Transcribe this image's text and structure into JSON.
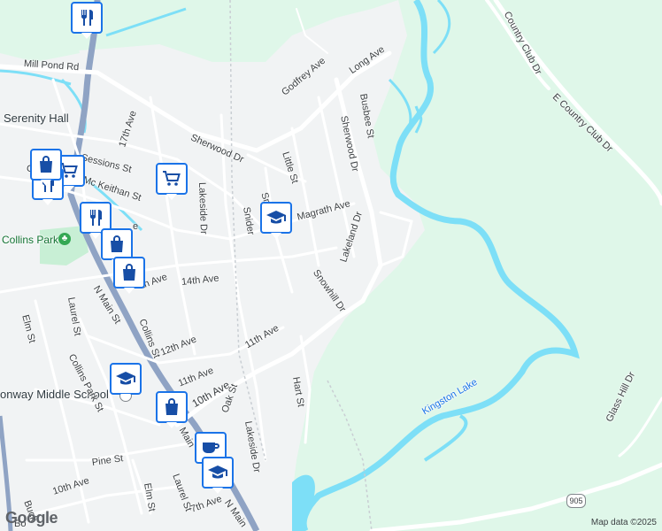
{
  "map": {
    "attribution": "Map data ©2025",
    "logo": "Google",
    "colors": {
      "urban": "#f1f3f4",
      "green": "#dff7e9",
      "water": "#7ddff7",
      "road": "#ffffff",
      "highway": "#8fa3c4",
      "pin_border": "#1a73e8",
      "pin_icon": "#174ea6"
    },
    "places": {
      "serenity_hall": "Serenity Hall",
      "collins_park": "Collins Park",
      "middle_school": "onway Middle School",
      "kingston_lake": "Kingston Lake"
    },
    "streets": {
      "mill_pond": "Mill Pond Rd",
      "long_ave": "Long Ave",
      "godfrey": "Godfrey Ave",
      "busbee": "Busbee St",
      "sherwood_dr": "Sherwood Dr",
      "sherwood_dr2": "Sherwood Dr",
      "little": "Little St",
      "seventeenth": "17th Ave",
      "sessions": "Sessions St",
      "mckeithan": "Mc Keithan St",
      "lakeside": "Lakeside Dr",
      "snider": "Snider",
      "snow": "Snow",
      "magrath": "Magrath Ave",
      "lakeland": "Lakeland Dr",
      "snowhill": "Snowhill Dr",
      "fourteenth": "14th Ave",
      "fourteenth_partial": "th Ave",
      "laurel": "Laurel St",
      "elm": "Elm St",
      "n_main": "N Main St",
      "collins": "Collins St",
      "collins_park_st": "Collins Park St",
      "twelfth": "12th Ave",
      "eleventh": "11th Ave",
      "eleventh2": "11th Ave",
      "hart": "Hart St",
      "tenth": "10th Ave",
      "oak": "Oak St",
      "lakeside2": "Lakeside Dr",
      "main_partial": "Main",
      "pine": "Pine St",
      "tenth2": "10th Ave",
      "elm2": "Elm St",
      "laurel2": "Laurel St",
      "seventh": "7th Ave",
      "n_main2": "N Main",
      "buck": "Buck",
      "country_club": "Country Club Dr",
      "e_country_club": "E Country Club Dr",
      "glass_hill": "Glass Hill Dr",
      "kingston_lake_label": "Kingston Lake",
      "lane_c": "C",
      "lane_e": "e",
      "bo": "Bo"
    },
    "route": "905",
    "pois": [
      {
        "icon": "restaurant-icon"
      },
      {
        "icon": "shopping-cart-icon"
      },
      {
        "icon": "shopping-cart-icon"
      },
      {
        "icon": "restaurant-icon"
      },
      {
        "icon": "shopping-bag-icon"
      },
      {
        "icon": "shopping-cart-icon"
      },
      {
        "icon": "restaurant-icon"
      },
      {
        "icon": "shopping-bag-icon"
      },
      {
        "icon": "shopping-bag-icon"
      },
      {
        "icon": "school-icon"
      },
      {
        "icon": "school-icon"
      },
      {
        "icon": "shopping-bag-icon"
      },
      {
        "icon": "cafe-icon"
      },
      {
        "icon": "school-icon"
      }
    ]
  }
}
